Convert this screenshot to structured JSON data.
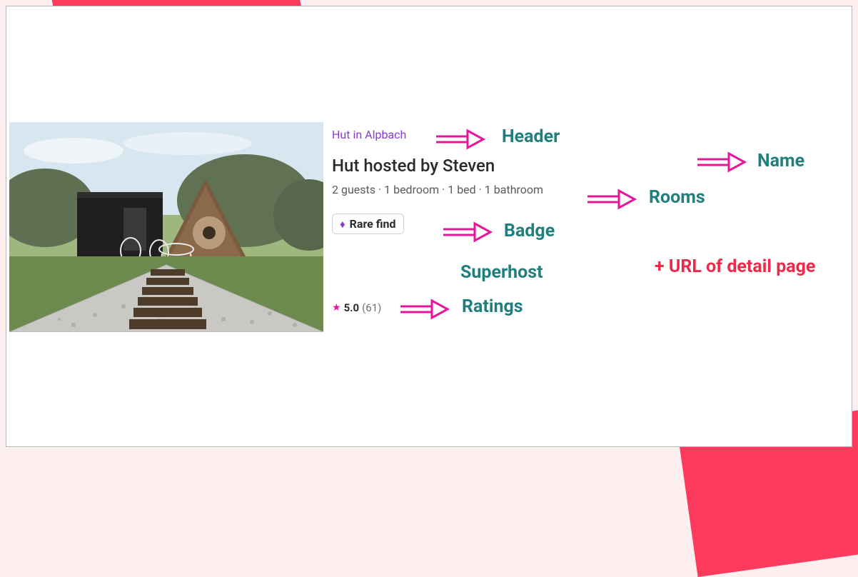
{
  "listing": {
    "header": "Hut in Alpbach",
    "name": "Hut hosted by Steven",
    "rooms": "2 guests · 1 bedroom · 1 bed · 1 bathroom",
    "badge": "Rare find",
    "rating_value": "5.0",
    "rating_count": "(61)"
  },
  "annotations": {
    "header": "Header",
    "name": "Name",
    "rooms": "Rooms",
    "badge": "Badge",
    "superhost": "Superhost",
    "ratings": "Ratings",
    "url_note": "+ URL of detail page"
  }
}
